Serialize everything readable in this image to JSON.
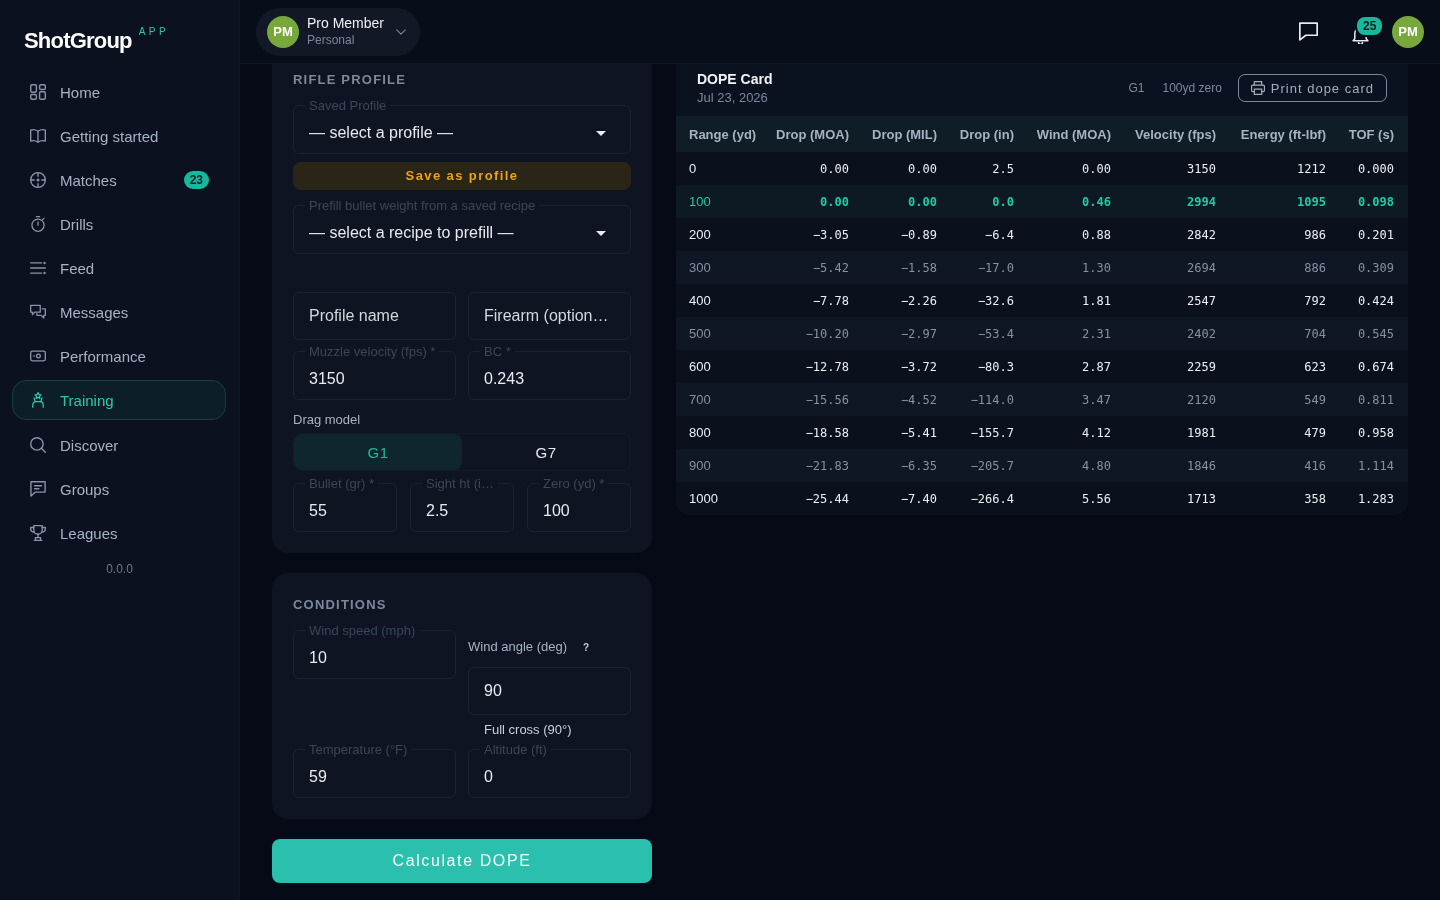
{
  "sidebar": {
    "logo": "ShotGroup",
    "logo_tag": "APP",
    "sections": [
      {
        "items": [
          {
            "label": "Home",
            "selected": false
          },
          {
            "label": "Getting started",
            "selected": false
          },
          {
            "label": "Matches",
            "badge": "23",
            "selected": false
          },
          {
            "label": "Drills",
            "selected": false
          },
          {
            "label": "Feed",
            "selected": false
          },
          {
            "label": "Messages",
            "selected": false
          },
          {
            "label": "Performance",
            "selected": false
          },
          {
            "label": "Training",
            "selected": true
          }
        ]
      },
      {
        "items": [
          {
            "label": "Discover",
            "selected": false
          },
          {
            "label": "Groups",
            "selected": false
          },
          {
            "label": "Leagues",
            "selected": false
          }
        ]
      }
    ],
    "version": "0.0.0"
  },
  "header": {
    "account": {
      "initials": "PM",
      "name": "Pro Member",
      "plan": "Personal"
    },
    "notification_count": "25",
    "user_initials": "PM"
  },
  "rifle_profile": {
    "title": "RIFLE PROFILE",
    "saved_profile": {
      "label": "Saved Profile",
      "value": "— select a profile —"
    },
    "save_button": "Save as profile",
    "recipe": {
      "label": "Prefill bullet weight from a saved recipe",
      "value": "— select a recipe to prefill —"
    },
    "name_fields": [
      {
        "placeholder": "Profile name"
      },
      {
        "placeholder": "Firearm (option…"
      }
    ],
    "ballistic_fields": [
      {
        "label": "Muzzle velocity (fps) *",
        "value": "3150"
      },
      {
        "label": "BC *",
        "value": "0.243"
      }
    ],
    "drag_model": {
      "label": "Drag model",
      "options": [
        {
          "label": "G1",
          "selected": true
        },
        {
          "label": "G7",
          "selected": false
        }
      ]
    },
    "load_fields": [
      {
        "label": "Bullet (gr) *",
        "value": "55"
      },
      {
        "label": "Sight ht (i…",
        "value": "2.5"
      },
      {
        "label": "Zero (yd) *",
        "value": "100"
      }
    ]
  },
  "conditions": {
    "title": "CONDITIONS",
    "fields": [
      {
        "kind": "outlined",
        "label": "Wind speed (mph)",
        "value": "10"
      },
      {
        "kind": "stacked",
        "label": "Wind angle (deg)",
        "help": "?",
        "value": "90",
        "helper": "Full cross (90°)"
      },
      {
        "kind": "outlined",
        "label": "Temperature (°F)",
        "value": "59"
      },
      {
        "kind": "outlined",
        "label": "Altitude (ft)",
        "value": "0"
      }
    ]
  },
  "calculate_button": "Calculate DOPE",
  "dope_card": {
    "title": "DOPE Card",
    "date": "Jul 23, 2026",
    "drag_model": "G1",
    "zero": "100yd zero",
    "print_button": "Print dope card",
    "columns": [
      "Range (yd)",
      "Drop (MOA)",
      "Drop (MIL)",
      "Drop (in)",
      "Wind (MOA)",
      "Velocity (fps)",
      "Energy (ft-lbf)",
      "TOF (s)"
    ],
    "rows": [
      {
        "cells": [
          "0",
          "0.00",
          "0.00",
          "2.5",
          "0.00",
          "3150",
          "1212",
          "0.000"
        ],
        "highlighted": false
      },
      {
        "cells": [
          "100",
          "0.00",
          "0.00",
          "0.0",
          "0.46",
          "2994",
          "1095",
          "0.098"
        ],
        "highlighted": true
      },
      {
        "cells": [
          "200",
          "−3.05",
          "−0.89",
          "−6.4",
          "0.88",
          "2842",
          "986",
          "0.201"
        ],
        "highlighted": false
      },
      {
        "cells": [
          "300",
          "−5.42",
          "−1.58",
          "−17.0",
          "1.30",
          "2694",
          "886",
          "0.309"
        ],
        "highlighted": false
      },
      {
        "cells": [
          "400",
          "−7.78",
          "−2.26",
          "−32.6",
          "1.81",
          "2547",
          "792",
          "0.424"
        ],
        "highlighted": false
      },
      {
        "cells": [
          "500",
          "−10.20",
          "−2.97",
          "−53.4",
          "2.31",
          "2402",
          "704",
          "0.545"
        ],
        "highlighted": false
      },
      {
        "cells": [
          "600",
          "−12.78",
          "−3.72",
          "−80.3",
          "2.87",
          "2259",
          "623",
          "0.674"
        ],
        "highlighted": false
      },
      {
        "cells": [
          "700",
          "−15.56",
          "−4.52",
          "−114.0",
          "3.47",
          "2120",
          "549",
          "0.811"
        ],
        "highlighted": false
      },
      {
        "cells": [
          "800",
          "−18.58",
          "−5.41",
          "−155.7",
          "4.12",
          "1981",
          "479",
          "0.958"
        ],
        "highlighted": false
      },
      {
        "cells": [
          "900",
          "−21.83",
          "−6.35",
          "−205.7",
          "4.80",
          "1846",
          "416",
          "1.114"
        ],
        "highlighted": false
      },
      {
        "cells": [
          "1000",
          "−25.44",
          "−7.40",
          "−266.4",
          "5.56",
          "1713",
          "358",
          "1.283"
        ],
        "highlighted": false
      }
    ]
  }
}
